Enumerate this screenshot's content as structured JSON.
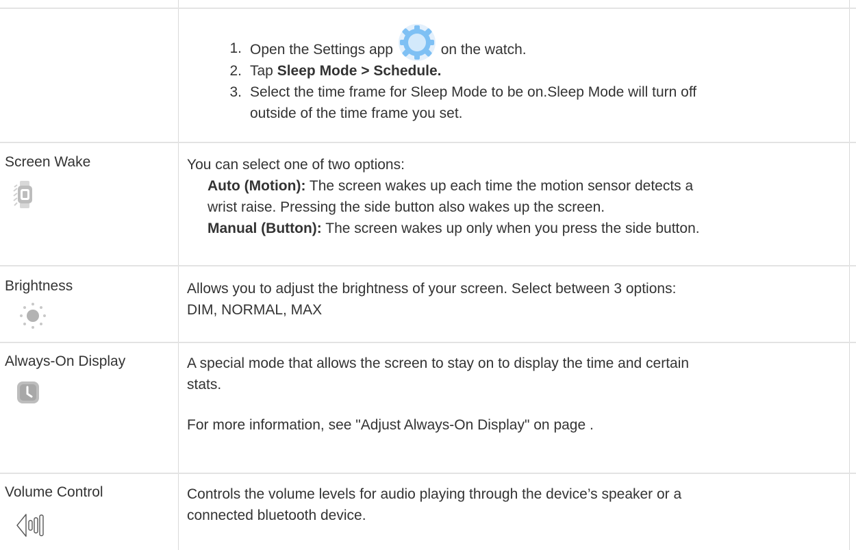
{
  "top_steps": {
    "step1": {
      "num": "1.",
      "before": "Open the Settings app",
      "after": "on the watch."
    },
    "step2": {
      "num": "2.",
      "before": "Tap",
      "bold": "Sleep Mode > Schedule."
    },
    "step3": {
      "num": "3.",
      "line1": "Select the time frame for Sleep Mode to be on.Sleep Mode will turn off",
      "line2": "outside of the time frame you set."
    }
  },
  "rows": {
    "screen_wake": {
      "label": "Screen Wake",
      "icon": "watch-wake-icon",
      "intro": "You can select one of two options:",
      "auto_bold": "Auto (Motion):",
      "auto_line1": "The screen wakes up each time the motion sensor detects a",
      "auto_line2": "wrist raise. Pressing the side button also wakes up the screen.",
      "manual_bold": "Manual (Button):",
      "manual_text": "The screen wakes up only when you press the side button."
    },
    "brightness": {
      "label": "Brightness",
      "icon": "brightness-sun-icon",
      "line1": "Allows you to adjust the brightness of your screen. Select between 3 options:",
      "line2": "DIM, NORMAL, MAX"
    },
    "aod": {
      "label": "Always-On Display",
      "icon": "clock-icon",
      "line1": "A special mode that allows the screen to stay on to display the time and certain",
      "line2": "stats.",
      "more": "For more information, see \"Adjust Always-On Display\" on page ."
    },
    "volume": {
      "label": "Volume Control",
      "icon": "volume-icon",
      "line1": "Controls the volume levels for audio playing through the device’s speaker or a",
      "line2": "connected bluetooth device."
    }
  }
}
